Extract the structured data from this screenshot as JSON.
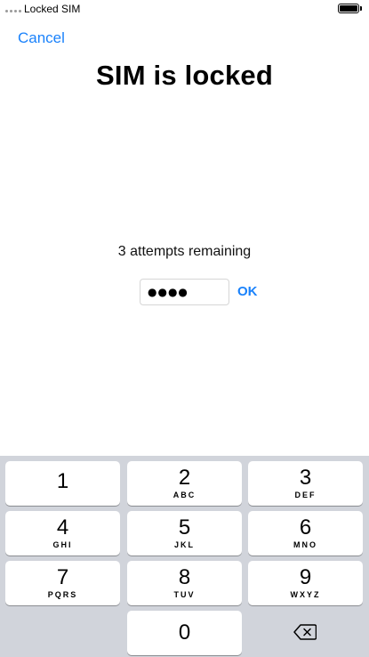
{
  "status_bar": {
    "carrier": "Locked SIM",
    "signal_icon": "signal-dots-icon",
    "battery_icon": "battery-icon"
  },
  "nav": {
    "cancel_label": "Cancel"
  },
  "title": "SIM is locked",
  "attempts_text": "3 attempts remaining",
  "pin": {
    "masked_value": "●●●●",
    "length": 4
  },
  "ok_label": "OK",
  "keypad": {
    "keys": [
      {
        "digit": "1",
        "letters": ""
      },
      {
        "digit": "2",
        "letters": "ABC"
      },
      {
        "digit": "3",
        "letters": "DEF"
      },
      {
        "digit": "4",
        "letters": "GHI"
      },
      {
        "digit": "5",
        "letters": "JKL"
      },
      {
        "digit": "6",
        "letters": "MNO"
      },
      {
        "digit": "7",
        "letters": "PQRS"
      },
      {
        "digit": "8",
        "letters": "TUV"
      },
      {
        "digit": "9",
        "letters": "WXYZ"
      },
      {
        "digit": "0",
        "letters": ""
      }
    ],
    "delete_icon": "backspace-icon"
  },
  "colors": {
    "accent": "#1a82fb",
    "keypad_background": "#d1d4db",
    "key_background": "#ffffff"
  }
}
